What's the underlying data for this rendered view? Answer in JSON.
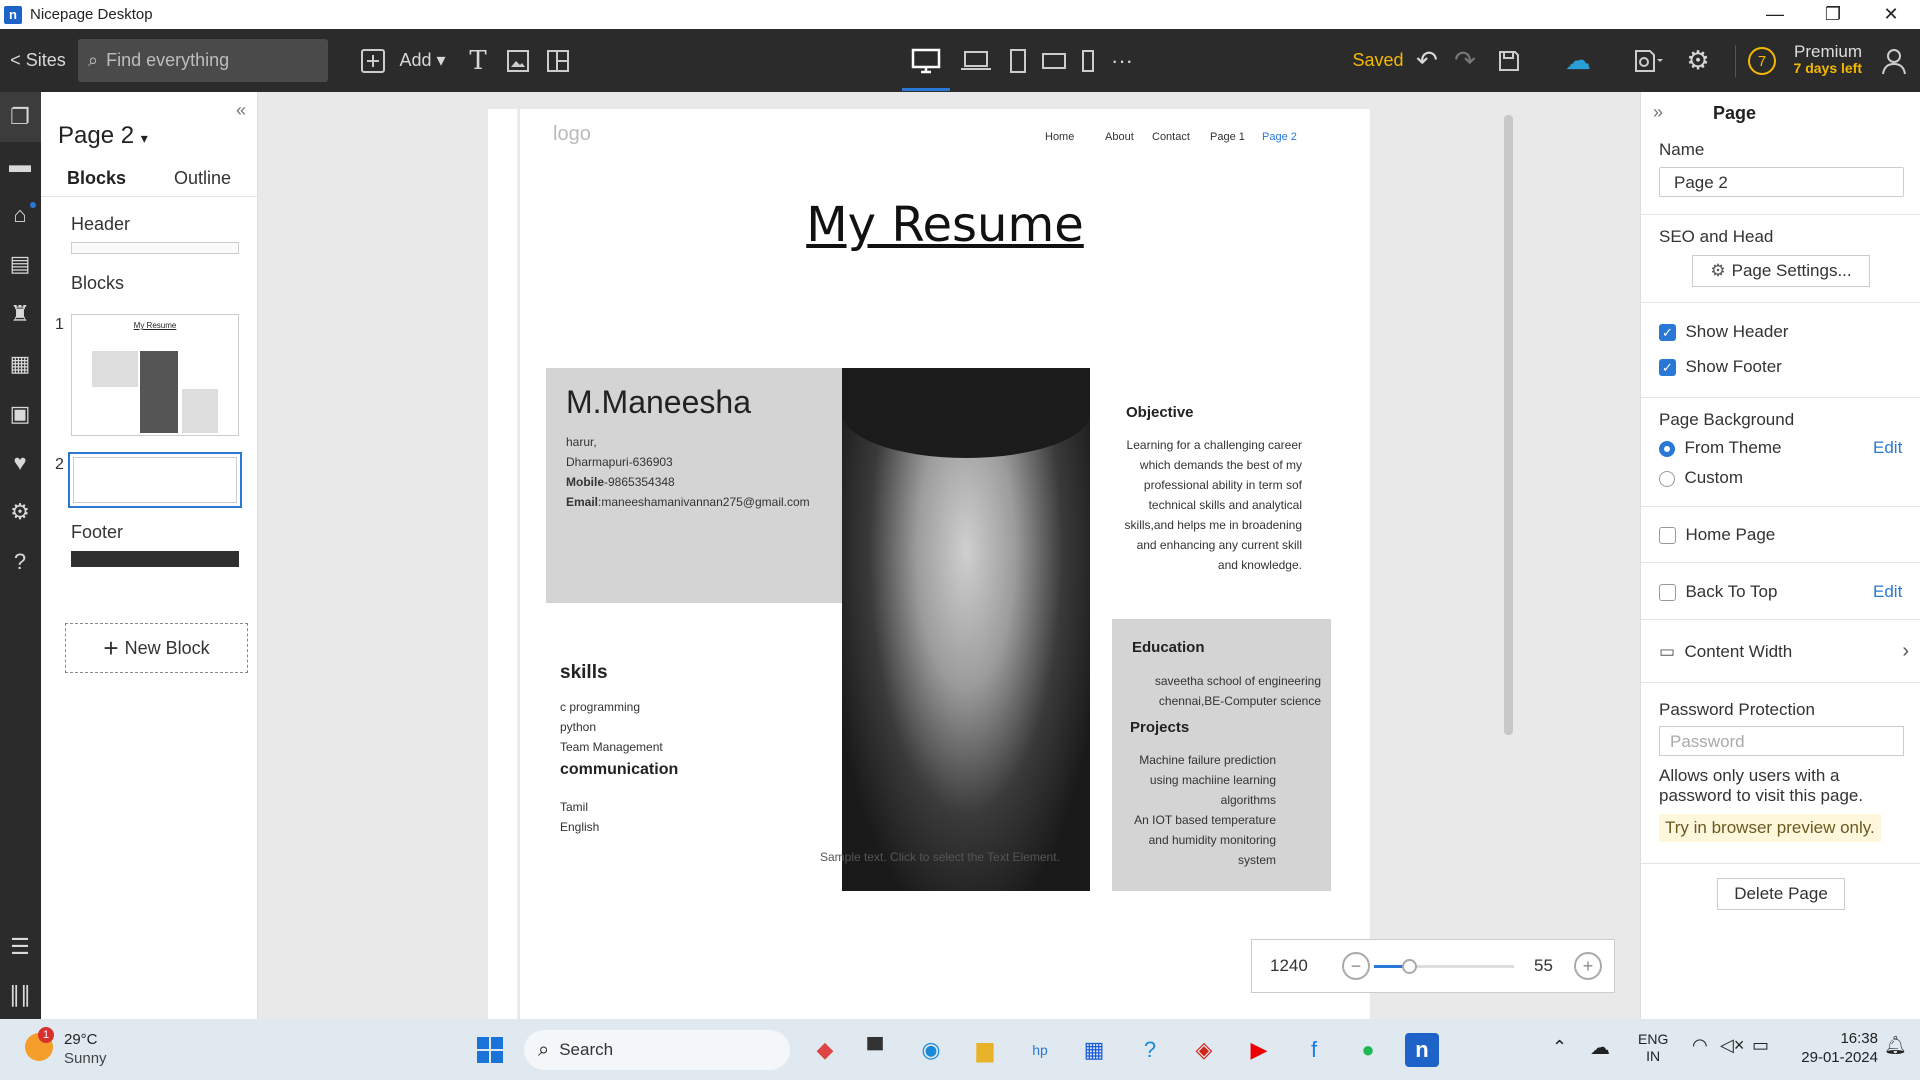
{
  "window": {
    "title": "Nicepage Desktop",
    "logo_letter": "n"
  },
  "toolbar": {
    "sites_label": "< Sites",
    "search_placeholder": "Find everything",
    "add_label": "Add",
    "saved_label": "Saved",
    "premium_badge": "7",
    "premium_label": "Premium",
    "premium_sub": "7 days left"
  },
  "left_panel": {
    "page_title": "Page 2",
    "tabs": [
      "Blocks",
      "Outline"
    ],
    "header_label": "Header",
    "blocks_label": "Blocks",
    "block_numbers": [
      "1",
      "2"
    ],
    "thumb_title": "My Resume",
    "footer_label": "Footer",
    "new_block_label": "New Block"
  },
  "page": {
    "logo": "logo",
    "nav": [
      "Home",
      "About",
      "Contact",
      "Page 1",
      "Page 2"
    ],
    "title": "My Resume",
    "name": "M.Maneesha",
    "address1": "harur,",
    "address2": "Dharmapuri-636903",
    "mobile_label": "Mobile",
    "mobile": "-9865354348",
    "email_label": "Email",
    "email": ":maneeshamanivannan275@gmail.com",
    "skills_heading": "skills",
    "skills": [
      "c programming",
      "python",
      "Team Management"
    ],
    "comm_heading": "communication",
    "languages": [
      "Tamil",
      "English"
    ],
    "sample_text": "Sample text. Click to select the Text Element.",
    "objective_heading": "Objective",
    "objective_text": "Learning for a challenging career which demands the best of my professional ability in term sof technical skills and analytical skills,and helps me in broadening and enhancing any current skill and knowledge.",
    "education_heading": "Education",
    "education_text": "saveetha school of engineering chennai,BE-Computer science",
    "projects_heading": "Projects",
    "projects_text1": "Machine failure prediction using machiine learning algorithms",
    "projects_text2": "An IOT based temperature and humidity monitoring system"
  },
  "zoom": {
    "width": "1240",
    "percent": "55",
    "level": 0.25
  },
  "right_panel": {
    "title": "Page",
    "name_label": "Name",
    "name_value": "Page 2",
    "seo_label": "SEO and Head",
    "settings_button": "Page Settings...",
    "show_header": "Show Header",
    "show_footer": "Show Footer",
    "bg_label": "Page Background",
    "from_theme": "From Theme",
    "edit": "Edit",
    "custom": "Custom",
    "home_page": "Home Page",
    "back_to_top": "Back To Top",
    "content_width": "Content Width",
    "password_label": "Password Protection",
    "password_placeholder": "Password",
    "password_help": "Allows only users with a password to visit this page.",
    "preview_note": "Try in browser preview only.",
    "delete_button": "Delete Page"
  },
  "taskbar": {
    "temp": "29°C",
    "weather": "Sunny",
    "weather_badge": "1",
    "search_label": "Search",
    "lang1": "ENG",
    "lang2": "IN",
    "time": "16:38",
    "date": "29-01-2024"
  },
  "colors": {
    "accent": "#2a78d6",
    "toolbar_bg": "#2b2b2b",
    "saved": "#f5b800",
    "preview_bg": "#fff7dc"
  }
}
